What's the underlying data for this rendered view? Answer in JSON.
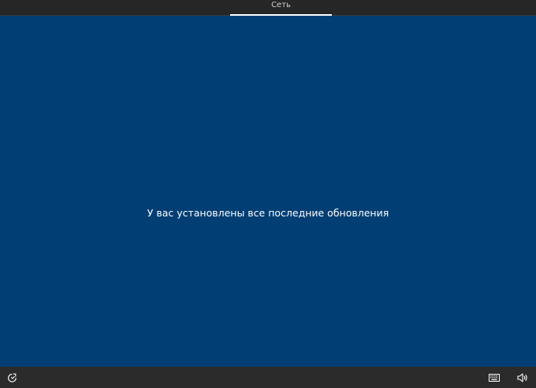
{
  "header": {
    "tab_label": "Сеть"
  },
  "main": {
    "message": "У вас установлены все последние обновления"
  },
  "bottombar": {
    "left_icon": "ease-of-access-icon",
    "right_icons": [
      "keyboard-icon",
      "volume-icon"
    ]
  },
  "colors": {
    "background": "#003E73",
    "topbar": "#262626",
    "bottombar": "#2B2B2B",
    "text": "#FFFFFF"
  }
}
